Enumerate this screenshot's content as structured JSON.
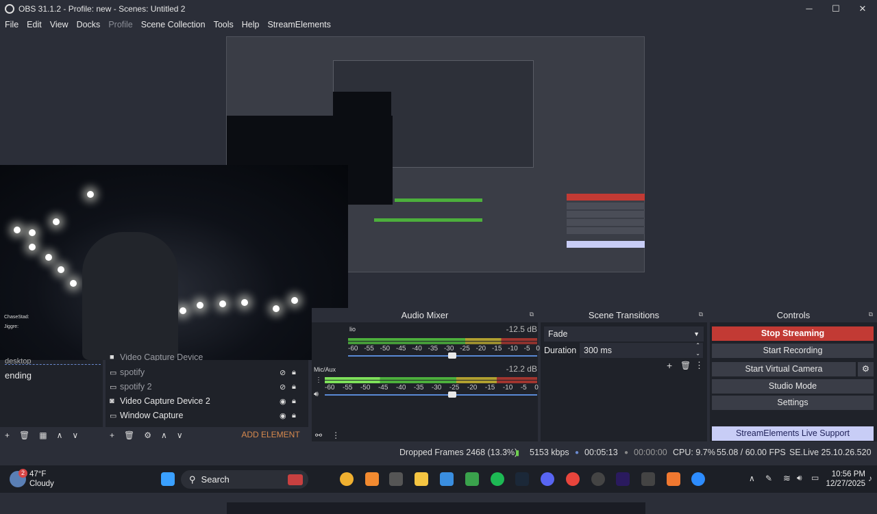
{
  "window": {
    "title": "OBS 31.1.2 - Profile: new - Scenes: Untitled 2"
  },
  "menu": [
    "File",
    "Edit",
    "View",
    "Docks",
    "Profile",
    "Scene Collection",
    "Tools",
    "Help",
    "StreamElements"
  ],
  "preview": {
    "chat_line_1": "ChaseStad:",
    "chat_line_2": "Jiggre:"
  },
  "docks": {
    "audio_mixer": "Audio Mixer",
    "scene_transitions": "Scene Transitions",
    "controls": "Controls"
  },
  "scenes": {
    "items": [
      "desktop",
      "ending"
    ]
  },
  "sources": {
    "items": [
      {
        "name": "Video Capture Device",
        "icon": "camera-icon",
        "visible": false
      },
      {
        "name": "spotify",
        "icon": "window-icon",
        "visible": false
      },
      {
        "name": "spotify 2",
        "icon": "window-icon",
        "visible": false
      },
      {
        "name": "Video Capture Device 2",
        "icon": "camera-icon",
        "visible": true
      },
      {
        "name": "Window Capture",
        "icon": "window-icon",
        "visible": true
      }
    ],
    "add_element": "ADD ELEMENT"
  },
  "mixer": {
    "channels": [
      {
        "name": "lio",
        "db": "-12.5 dB"
      },
      {
        "name": "Mic/Aux",
        "db": "-12.2 dB"
      }
    ],
    "ticks": [
      "-60",
      "-55",
      "-50",
      "-45",
      "-40",
      "-35",
      "-30",
      "-25",
      "-20",
      "-15",
      "-10",
      "-5",
      "0"
    ]
  },
  "transitions": {
    "selected": "Fade",
    "duration_label": "Duration",
    "duration_value": "300 ms"
  },
  "controls": {
    "stop_streaming": "Stop Streaming",
    "start_recording": "Start Recording",
    "start_virtual_camera": "Start Virtual Camera",
    "studio_mode": "Studio Mode",
    "settings": "Settings",
    "live_support": "StreamElements Live Support"
  },
  "status": {
    "dropped_frames": "Dropped Frames 2468 (13.3%)",
    "bitrate": "5153 kbps",
    "stream_time": "00:05:13",
    "record_time": "00:00:00",
    "cpu": "CPU: 9.7%",
    "fps": "55.08 / 60.00 FPS",
    "se_version": "SE.Live 25.10.26.520"
  },
  "taskbar": {
    "weather_temp": "47°F",
    "weather_desc": "Cloudy",
    "weather_badge": "2",
    "search": "Search",
    "time": "10:56 PM",
    "date": "12/27/2025"
  },
  "colors": {
    "accent_red": "#c23a34",
    "support_bg": "#c8cdf6",
    "meter_green": "#4caf3c"
  }
}
